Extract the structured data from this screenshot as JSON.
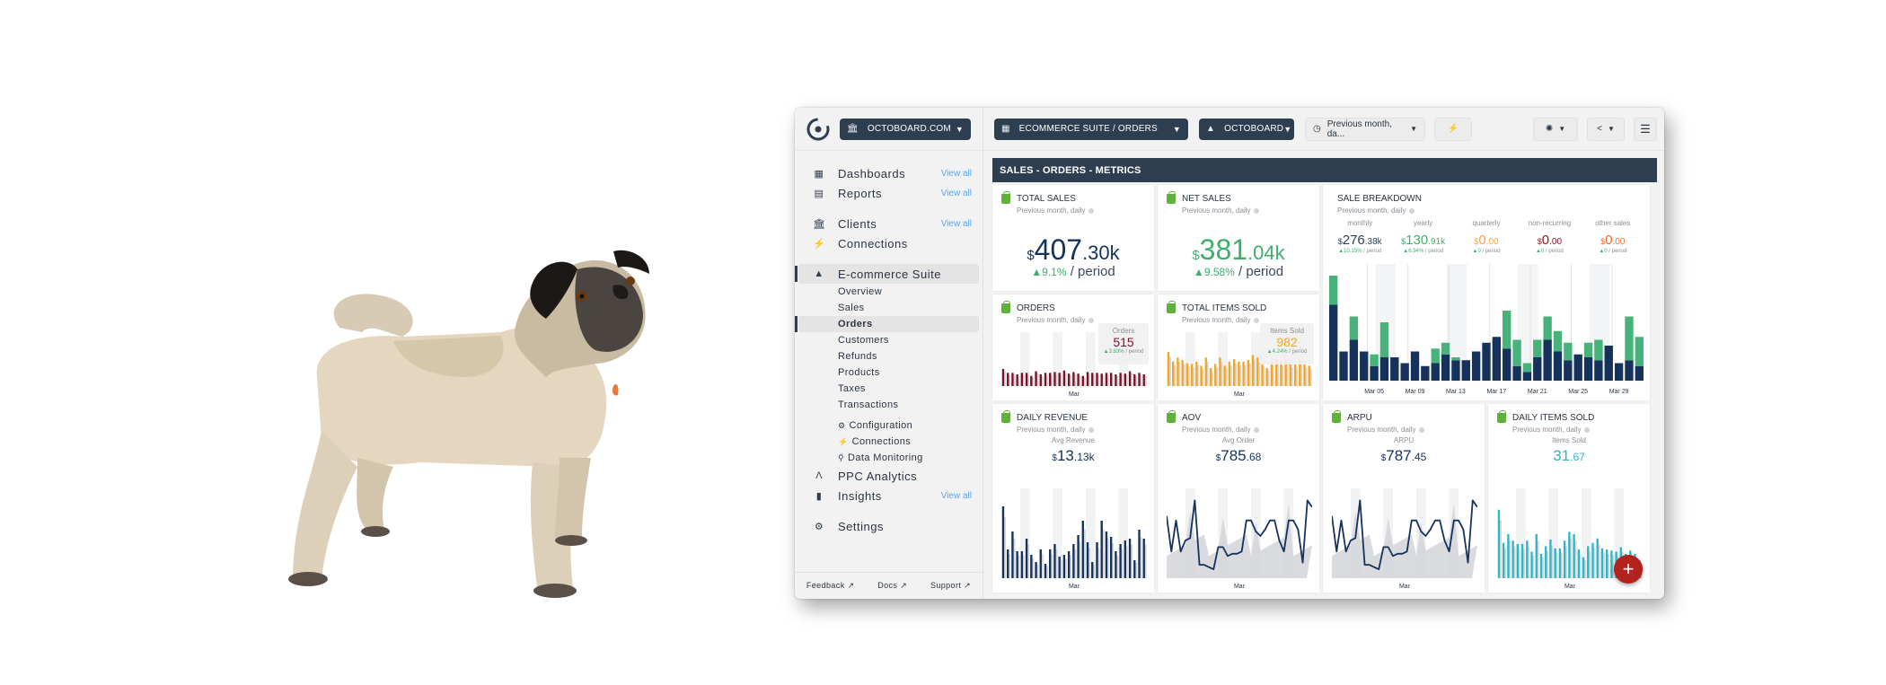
{
  "sidebar": {
    "org_selector": "OCTOBOARD.COM",
    "items": [
      {
        "label": "Dashboards",
        "icon": "dashboard-icon",
        "view_all": "View all"
      },
      {
        "label": "Reports",
        "icon": "clipboard-icon",
        "view_all": "View all"
      },
      {
        "label": "Clients",
        "icon": "bank-icon",
        "view_all": "View all"
      },
      {
        "label": "Connections",
        "icon": "plug-icon"
      },
      {
        "label": "E-commerce Suite",
        "icon": "shopping-bag-icon"
      },
      {
        "label": "PPC Analytics",
        "icon": "ppc-icon"
      },
      {
        "label": "Insights",
        "icon": "bar-chart-icon",
        "view_all": "View all"
      },
      {
        "label": "Settings",
        "icon": "gear-icon"
      }
    ],
    "suite_subitems": [
      "Overview",
      "Sales",
      "Orders",
      "Customers",
      "Refunds",
      "Products",
      "Taxes",
      "Transactions"
    ],
    "suite_tools": [
      {
        "label": "Configuration",
        "icon": "gear-icon"
      },
      {
        "label": "Connections",
        "icon": "plug-icon"
      },
      {
        "label": "Data Monitoring",
        "icon": "search-icon"
      }
    ],
    "active_subitem": "Orders",
    "footer": [
      "Feedback",
      "Docs",
      "Support"
    ]
  },
  "topbar": {
    "dashboard_selector": "ECOMMERCE SUITE / ORDERS",
    "account_selector": "OCTOBOARD",
    "date_range": "Previous month, da...",
    "plug_button": "plug-icon",
    "theme_button": "palette-icon",
    "share_button": "share-icon",
    "menu_button": "hamburger-icon"
  },
  "section": {
    "title": "SALES - ORDERS - METRICS"
  },
  "cards": {
    "subtitle": "Previous month, daily",
    "period_suffix": "/ period",
    "total_sales": {
      "title": "TOTAL SALES",
      "currency": "$",
      "int": "407",
      "dec": ".30k",
      "change": "9.1%"
    },
    "net_sales": {
      "title": "NET SALES",
      "currency": "$",
      "int": "381",
      "dec": ".04k",
      "change": "9.58%"
    },
    "orders": {
      "title": "ORDERS",
      "label": "Orders",
      "value": "515",
      "change": "3.83%",
      "xlabel": "Mar"
    },
    "items_sold": {
      "title": "TOTAL ITEMS SOLD",
      "label": "Items Sold",
      "value": "982",
      "change": "4.24%",
      "xlabel": "Mar"
    },
    "daily_revenue": {
      "title": "DAILY REVENUE",
      "label": "Avg Revenue",
      "currency": "$",
      "int": "13",
      "dec": ".13k",
      "xlabel": "Mar"
    },
    "aov": {
      "title": "AOV",
      "label": "Avg Order",
      "currency": "$",
      "int": "785",
      "dec": ".68",
      "xlabel": "Mar"
    },
    "arpu": {
      "title": "ARPU",
      "label": "ARPU",
      "currency": "$",
      "int": "787",
      "dec": ".45",
      "xlabel": "Mar"
    },
    "daily_items": {
      "title": "DAILY ITEMS SOLD",
      "label": "Items Sold",
      "int": "31",
      "dec": ".67",
      "xlabel": "Mar"
    },
    "breakdown": {
      "title": "SALE BREAKDOWN",
      "columns": [
        {
          "label": "monthly",
          "currency": "$",
          "int": "276",
          "dec": ".38k",
          "change": "10.15%",
          "color": "#2e3e51"
        },
        {
          "label": "yearly",
          "currency": "$",
          "int": "130",
          "dec": ".91k",
          "change": "6.94%",
          "color": "#3fae6e"
        },
        {
          "label": "quarterly",
          "currency": "$",
          "int": "0",
          "dec": ".00",
          "change": "0",
          "color": "#f3a93b"
        },
        {
          "label": "non-recurring",
          "currency": "$",
          "int": "0",
          "dec": ".00",
          "change": "0",
          "color": "#8a1a2e"
        },
        {
          "label": "other sales",
          "currency": "$",
          "int": "0",
          "dec": ".00",
          "change": "0",
          "color": "#f06a2a"
        }
      ]
    }
  },
  "colors": {
    "navy": "#14325c",
    "green": "#47b37a",
    "maroon": "#7a1228",
    "orange": "#f3a623",
    "teal": "#2fb6c6",
    "header": "#2e3e51",
    "fab": "#b3221c"
  },
  "chart_data": [
    {
      "type": "bar",
      "title": "SALE BREAKDOWN",
      "stacked": true,
      "x_ticks": [
        "Mar 05",
        "Mar 09",
        "Mar 13",
        "Mar 17",
        "Mar 21",
        "Mar 25",
        "Mar 29"
      ],
      "categories": [
        "Mar 01",
        "Mar 02",
        "Mar 03",
        "Mar 04",
        "Mar 05",
        "Mar 06",
        "Mar 07",
        "Mar 08",
        "Mar 09",
        "Mar 10",
        "Mar 11",
        "Mar 12",
        "Mar 13",
        "Mar 14",
        "Mar 15",
        "Mar 16",
        "Mar 17",
        "Mar 18",
        "Mar 19",
        "Mar 20",
        "Mar 21",
        "Mar 22",
        "Mar 23",
        "Mar 24",
        "Mar 25",
        "Mar 26",
        "Mar 27",
        "Mar 28",
        "Mar 29",
        "Mar 30",
        "Mar 31"
      ],
      "series": [
        {
          "name": "monthly",
          "values": [
            26,
            10,
            14,
            10,
            5,
            8,
            8,
            6,
            10,
            5,
            6,
            9,
            7,
            7,
            10,
            13,
            15,
            11,
            5,
            3,
            8,
            14,
            10,
            7,
            9,
            8,
            7,
            12,
            6,
            7,
            5
          ]
        },
        {
          "name": "yearly",
          "values": [
            10,
            0,
            8,
            0,
            4,
            12,
            0,
            0,
            0,
            0,
            5,
            4,
            1,
            0,
            0,
            0,
            0,
            13,
            9,
            3,
            6,
            8,
            7,
            6,
            0,
            5,
            7,
            0,
            0,
            15,
            10
          ]
        }
      ]
    },
    {
      "type": "bar",
      "title": "ORDERS",
      "xlabel": "Mar",
      "values": [
        22,
        17,
        17,
        15,
        17,
        17,
        13,
        19,
        15,
        17,
        17,
        18,
        17,
        20,
        16,
        18,
        16,
        13,
        18,
        17,
        17,
        16,
        17,
        17,
        15,
        17,
        16,
        19,
        15,
        17,
        15
      ]
    },
    {
      "type": "bar",
      "title": "TOTAL ITEMS SOLD",
      "xlabel": "Mar",
      "values": [
        42,
        30,
        35,
        32,
        28,
        27,
        30,
        25,
        35,
        22,
        27,
        35,
        25,
        30,
        33,
        30,
        30,
        32,
        38,
        35,
        28,
        22,
        30,
        33,
        30,
        32,
        27,
        28,
        32,
        27,
        25
      ]
    },
    {
      "type": "bar",
      "title": "DAILY REVENUE",
      "xlabel": "Mar",
      "values": [
        40,
        16,
        26,
        15,
        15,
        22,
        13,
        9,
        16,
        8,
        16,
        19,
        12,
        13,
        15,
        19,
        24,
        32,
        20,
        9,
        20,
        32,
        26,
        23,
        15,
        19,
        21,
        22,
        10,
        27,
        22
      ]
    },
    {
      "type": "line",
      "title": "AOV",
      "xlabel": "Mar",
      "values": [
        860,
        700,
        840,
        700,
        750,
        760,
        930,
        640,
        640,
        630,
        620,
        720,
        720,
        680,
        690,
        690,
        700,
        840,
        840,
        790,
        770,
        800,
        840,
        840,
        750,
        700,
        840,
        840,
        800,
        650,
        930,
        900
      ]
    },
    {
      "type": "line",
      "title": "ARPU",
      "xlabel": "Mar",
      "values": [
        860,
        700,
        840,
        700,
        750,
        760,
        930,
        640,
        640,
        630,
        620,
        720,
        720,
        680,
        690,
        690,
        700,
        840,
        840,
        790,
        770,
        800,
        840,
        840,
        750,
        700,
        840,
        840,
        800,
        650,
        930,
        900
      ]
    },
    {
      "type": "bar",
      "title": "DAILY ITEMS SOLD",
      "xlabel": "Mar",
      "values": [
        62,
        32,
        40,
        34,
        31,
        31,
        34,
        24,
        40,
        22,
        29,
        35,
        27,
        27,
        34,
        42,
        40,
        26,
        19,
        29,
        32,
        36,
        27,
        26,
        25,
        24,
        28,
        22,
        25,
        22,
        16
      ]
    }
  ]
}
